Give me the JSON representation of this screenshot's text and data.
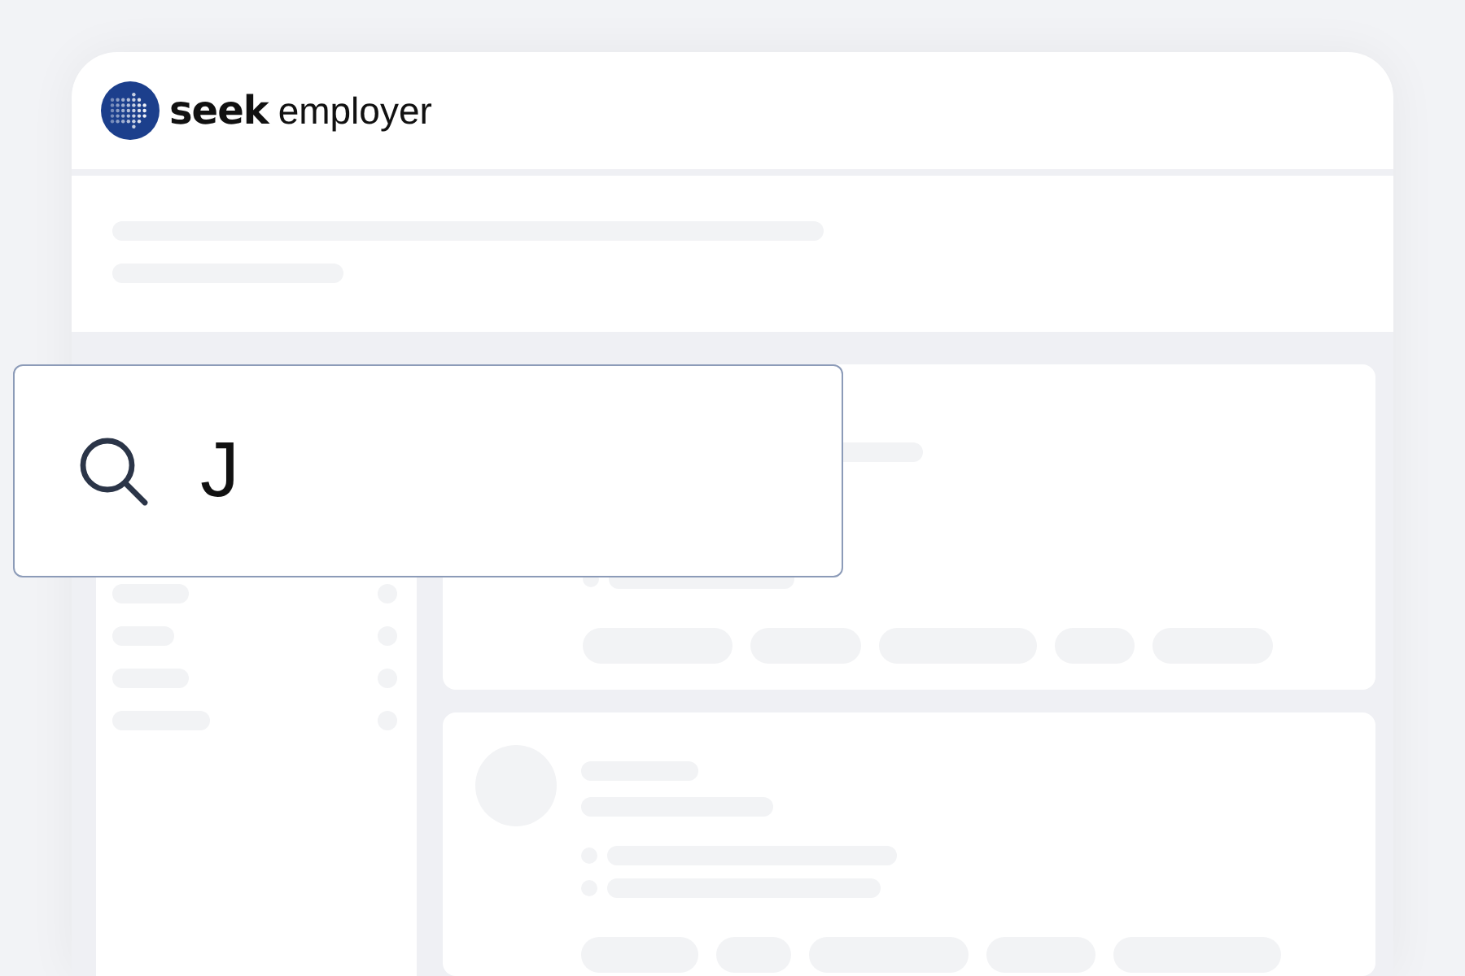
{
  "logo": {
    "primary": "seek",
    "secondary": "employer"
  },
  "search": {
    "value": "J"
  }
}
